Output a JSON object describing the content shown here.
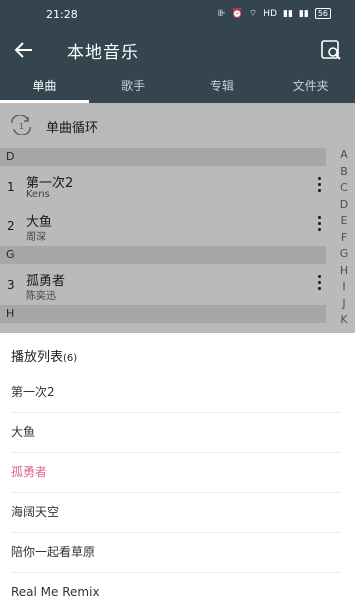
{
  "status_bar": {
    "time": "21:28",
    "icons_text": "HD",
    "battery": "56"
  },
  "app": {
    "title": "本地音乐"
  },
  "tabs": [
    {
      "label": "单曲",
      "active": true
    },
    {
      "label": "歌手",
      "active": false
    },
    {
      "label": "专辑",
      "active": false
    },
    {
      "label": "文件夹",
      "active": false
    }
  ],
  "play_mode": {
    "label": "单曲循环",
    "icon_text": "1"
  },
  "sections": [
    {
      "letter": "D"
    },
    {
      "letter": "G"
    },
    {
      "letter": "H"
    }
  ],
  "songs": [
    {
      "index": "1",
      "title": "第一次2",
      "artist": "Kens"
    },
    {
      "index": "2",
      "title": "大鱼",
      "artist": "周深"
    },
    {
      "index": "3",
      "title": "孤勇者",
      "artist": "陈奕迅"
    }
  ],
  "alphabet_index": [
    "A",
    "B",
    "C",
    "D",
    "E",
    "F",
    "G",
    "H",
    "I",
    "J",
    "K"
  ],
  "playlist": {
    "title": "播放列表",
    "count": "(6)",
    "current_color": "#e0648a",
    "items": [
      {
        "title": "第一次2",
        "current": false
      },
      {
        "title": "大鱼",
        "current": false
      },
      {
        "title": "孤勇者",
        "current": true
      },
      {
        "title": "海阔天空",
        "current": false
      },
      {
        "title": "陪你一起看草原",
        "current": false
      },
      {
        "title": "Real Me Remix",
        "current": false
      }
    ]
  },
  "colors": {
    "header_bg": "#34454f",
    "accent": "#e0648a"
  }
}
